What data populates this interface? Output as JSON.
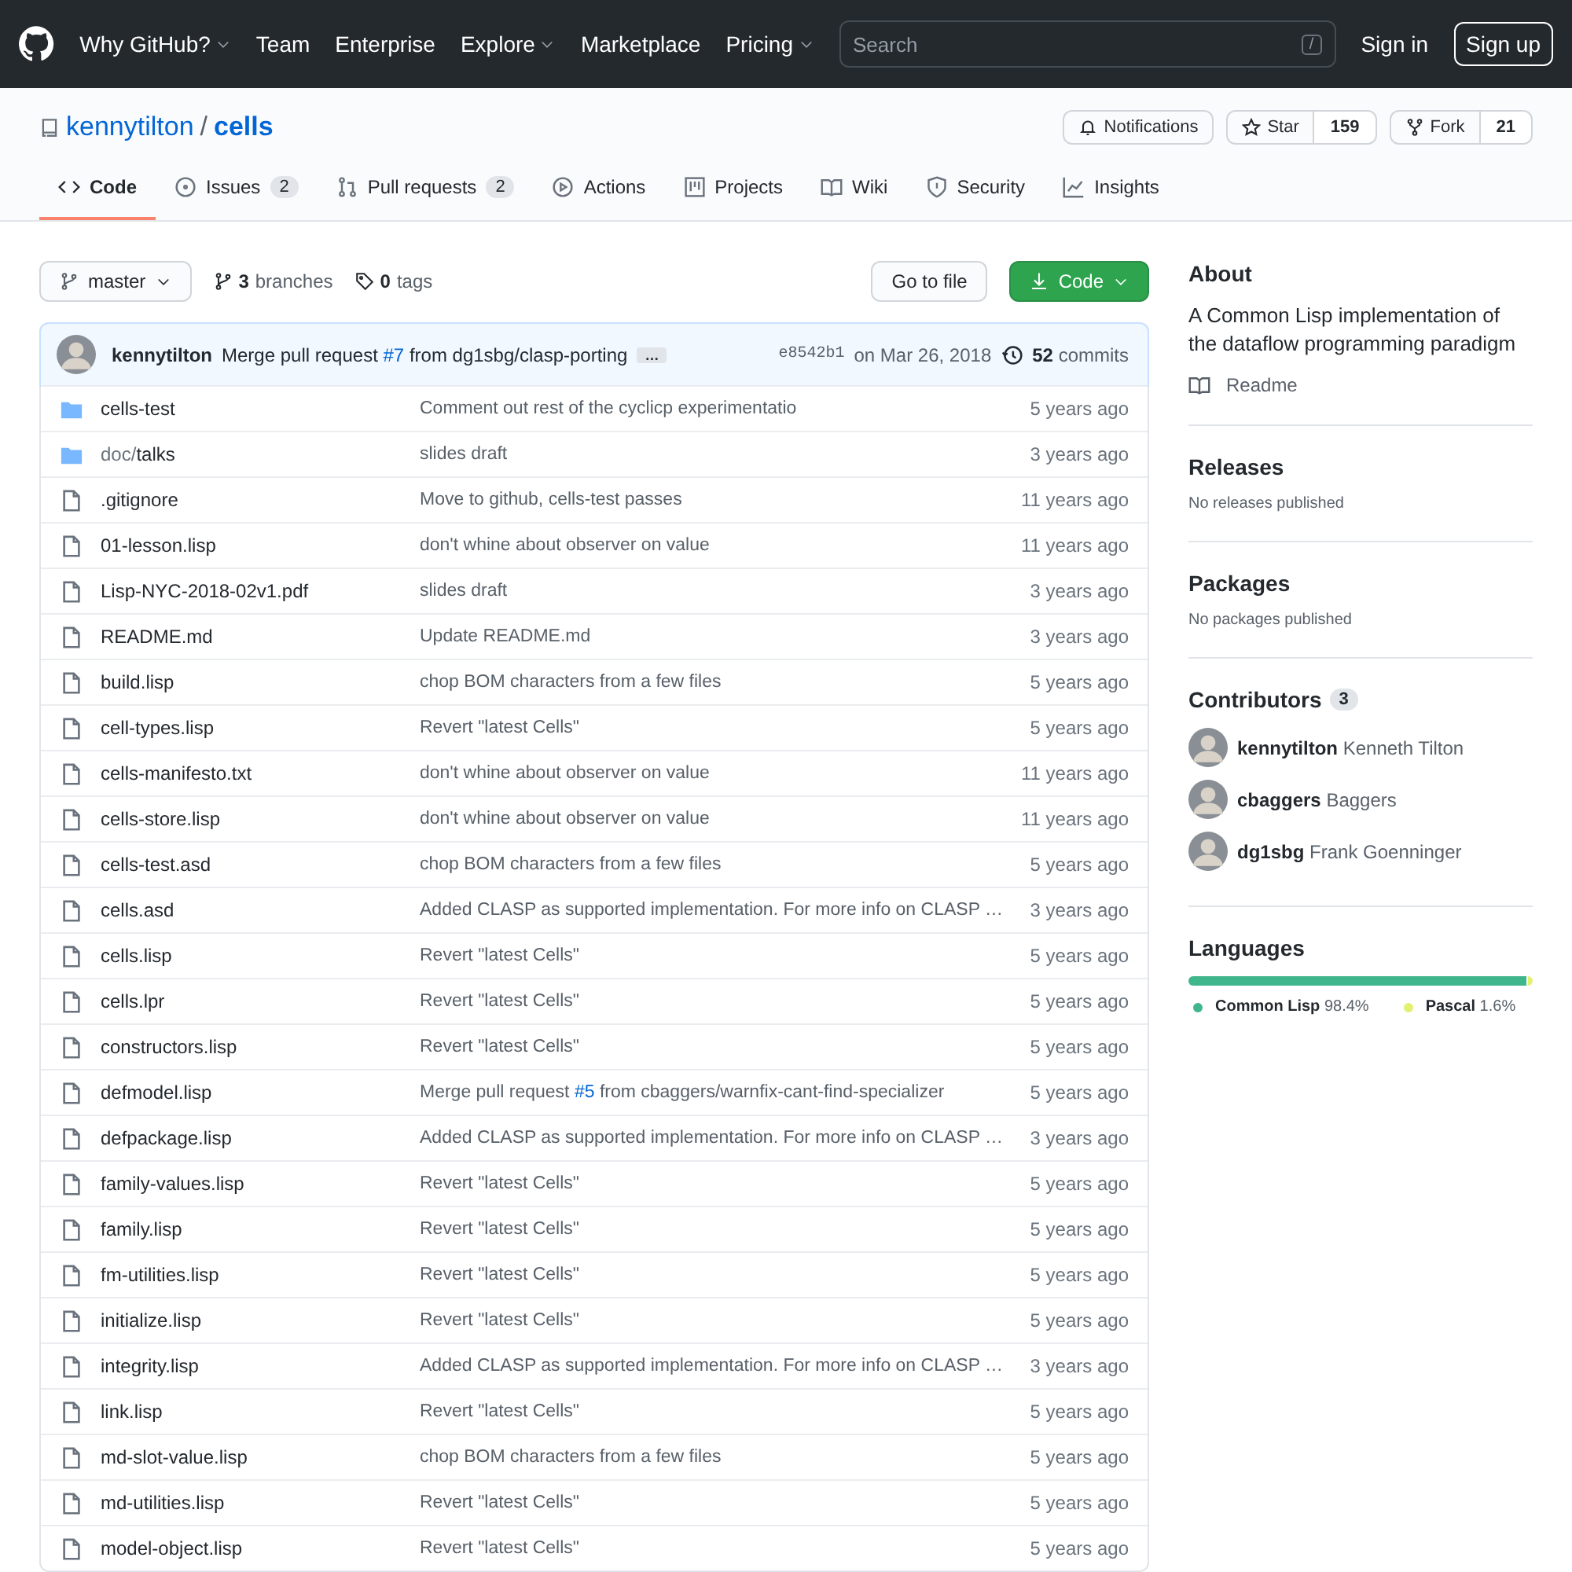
{
  "nav": {
    "links": [
      {
        "label": "Why GitHub?",
        "dropdown": true
      },
      {
        "label": "Team",
        "dropdown": false
      },
      {
        "label": "Enterprise",
        "dropdown": false
      },
      {
        "label": "Explore",
        "dropdown": true
      },
      {
        "label": "Marketplace",
        "dropdown": false
      },
      {
        "label": "Pricing",
        "dropdown": true
      }
    ],
    "search": {
      "placeholder": "Search",
      "shortcut": "/"
    },
    "sign_in": "Sign in",
    "sign_up": "Sign up"
  },
  "repo": {
    "owner": "kennytilton",
    "separator": "/",
    "name": "cells",
    "actions": [
      {
        "kind": "notifications",
        "label": "Notifications"
      },
      {
        "kind": "star",
        "label": "Star",
        "count": "159"
      },
      {
        "kind": "fork",
        "label": "Fork",
        "count": "21"
      }
    ]
  },
  "tabs": [
    {
      "kind": "code",
      "label": "Code",
      "selected": true
    },
    {
      "kind": "issues",
      "label": "Issues",
      "count": "2",
      "selected": false
    },
    {
      "kind": "pull",
      "label": "Pull requests",
      "count": "2",
      "selected": false
    },
    {
      "kind": "actions",
      "label": "Actions",
      "selected": false
    },
    {
      "kind": "projects",
      "label": "Projects",
      "selected": false
    },
    {
      "kind": "wiki",
      "label": "Wiki",
      "selected": false
    },
    {
      "kind": "security",
      "label": "Security",
      "selected": false
    },
    {
      "kind": "insights",
      "label": "Insights",
      "selected": false
    }
  ],
  "toolbar": {
    "branch": "master",
    "branches_count": "3",
    "branches_label": "branches",
    "tags_count": "0",
    "tags_label": "tags",
    "go_to_file": "Go to file",
    "code": "Code"
  },
  "latest_commit": {
    "author": "kennytilton",
    "message": [
      {
        "kind": "text",
        "text": "Merge pull request "
      },
      {
        "kind": "link",
        "text": "#7"
      },
      {
        "kind": "text",
        "text": " from dg1sbg/clasp-porting"
      }
    ],
    "ellipsis": "…",
    "sha": "e8542b1",
    "date": "on Mar 26, 2018",
    "commits_count": "52",
    "commits_label": "commits"
  },
  "files": [
    {
      "kind": "folder",
      "name": "cells-test",
      "message": [
        {
          "kind": "text",
          "text": "Comment out rest of the cyclicp experimentatio"
        }
      ],
      "age": "5 years ago"
    },
    {
      "kind": "folder",
      "prefix": "doc/",
      "name": "talks",
      "message": [
        {
          "kind": "text",
          "text": "slides draft"
        }
      ],
      "age": "3 years ago"
    },
    {
      "kind": "file",
      "name": ".gitignore",
      "message": [
        {
          "kind": "text",
          "text": "Move to github, cells-test passes"
        }
      ],
      "age": "11 years ago"
    },
    {
      "kind": "file",
      "name": "01-lesson.lisp",
      "message": [
        {
          "kind": "text",
          "text": "don't whine about observer on value"
        }
      ],
      "age": "11 years ago"
    },
    {
      "kind": "file",
      "name": "Lisp-NYC-2018-02v1.pdf",
      "message": [
        {
          "kind": "text",
          "text": "slides draft"
        }
      ],
      "age": "3 years ago"
    },
    {
      "kind": "file",
      "name": "README.md",
      "message": [
        {
          "kind": "text",
          "text": "Update README.md"
        }
      ],
      "age": "3 years ago"
    },
    {
      "kind": "file",
      "name": "build.lisp",
      "message": [
        {
          "kind": "text",
          "text": "chop BOM characters from a few files"
        }
      ],
      "age": "5 years ago"
    },
    {
      "kind": "file",
      "name": "cell-types.lisp",
      "message": [
        {
          "kind": "text",
          "text": "Revert \"latest Cells\""
        }
      ],
      "age": "5 years ago"
    },
    {
      "kind": "file",
      "name": "cells-manifesto.txt",
      "message": [
        {
          "kind": "text",
          "text": "don't whine about observer on value"
        }
      ],
      "age": "11 years ago"
    },
    {
      "kind": "file",
      "name": "cells-store.lisp",
      "message": [
        {
          "kind": "text",
          "text": "don't whine about observer on value"
        }
      ],
      "age": "11 years ago"
    },
    {
      "kind": "file",
      "name": "cells-test.asd",
      "message": [
        {
          "kind": "text",
          "text": "chop BOM characters from a few files"
        }
      ],
      "age": "5 years ago"
    },
    {
      "kind": "file",
      "name": "cells.asd",
      "message": [
        {
          "kind": "text",
          "text": "Added CLASP as supported implementation. For more info on CLASP …"
        }
      ],
      "age": "3 years ago"
    },
    {
      "kind": "file",
      "name": "cells.lisp",
      "message": [
        {
          "kind": "text",
          "text": "Revert \"latest Cells\""
        }
      ],
      "age": "5 years ago"
    },
    {
      "kind": "file",
      "name": "cells.lpr",
      "message": [
        {
          "kind": "text",
          "text": "Revert \"latest Cells\""
        }
      ],
      "age": "5 years ago"
    },
    {
      "kind": "file",
      "name": "constructors.lisp",
      "message": [
        {
          "kind": "text",
          "text": "Revert \"latest Cells\""
        }
      ],
      "age": "5 years ago"
    },
    {
      "kind": "file",
      "name": "defmodel.lisp",
      "message": [
        {
          "kind": "text",
          "text": "Merge pull request "
        },
        {
          "kind": "link",
          "text": "#5"
        },
        {
          "kind": "text",
          "text": " from cbaggers/warnfix-cant-find-specializer"
        }
      ],
      "age": "5 years ago"
    },
    {
      "kind": "file",
      "name": "defpackage.lisp",
      "message": [
        {
          "kind": "text",
          "text": "Added CLASP as supported implementation. For more info on CLASP …"
        }
      ],
      "age": "3 years ago"
    },
    {
      "kind": "file",
      "name": "family-values.lisp",
      "message": [
        {
          "kind": "text",
          "text": "Revert \"latest Cells\""
        }
      ],
      "age": "5 years ago"
    },
    {
      "kind": "file",
      "name": "family.lisp",
      "message": [
        {
          "kind": "text",
          "text": "Revert \"latest Cells\""
        }
      ],
      "age": "5 years ago"
    },
    {
      "kind": "file",
      "name": "fm-utilities.lisp",
      "message": [
        {
          "kind": "text",
          "text": "Revert \"latest Cells\""
        }
      ],
      "age": "5 years ago"
    },
    {
      "kind": "file",
      "name": "initialize.lisp",
      "message": [
        {
          "kind": "text",
          "text": "Revert \"latest Cells\""
        }
      ],
      "age": "5 years ago"
    },
    {
      "kind": "file",
      "name": "integrity.lisp",
      "message": [
        {
          "kind": "text",
          "text": "Added CLASP as supported implementation. For more info on CLASP …"
        }
      ],
      "age": "3 years ago"
    },
    {
      "kind": "file",
      "name": "link.lisp",
      "message": [
        {
          "kind": "text",
          "text": "Revert \"latest Cells\""
        }
      ],
      "age": "5 years ago"
    },
    {
      "kind": "file",
      "name": "md-slot-value.lisp",
      "message": [
        {
          "kind": "text",
          "text": "chop BOM characters from a few files"
        }
      ],
      "age": "5 years ago"
    },
    {
      "kind": "file",
      "name": "md-utilities.lisp",
      "message": [
        {
          "kind": "text",
          "text": "Revert \"latest Cells\""
        }
      ],
      "age": "5 years ago"
    },
    {
      "kind": "file",
      "name": "model-object.lisp",
      "message": [
        {
          "kind": "text",
          "text": "Revert \"latest Cells\""
        }
      ],
      "age": "5 years ago"
    }
  ],
  "sidebar": {
    "about": {
      "title": "About",
      "description": "A Common Lisp implementation of the dataflow programming paradigm",
      "readme": "Readme"
    },
    "releases": {
      "title": "Releases",
      "empty": "No releases published"
    },
    "packages": {
      "title": "Packages",
      "empty": "No packages published"
    },
    "contributors": {
      "title": "Contributors",
      "count": "3",
      "people": [
        {
          "login": "kennytilton",
          "name": "Kenneth Tilton"
        },
        {
          "login": "cbaggers",
          "name": "Baggers"
        },
        {
          "login": "dg1sbg",
          "name": "Frank Goenninger"
        }
      ]
    },
    "languages": {
      "title": "Languages",
      "items": [
        {
          "name": "Common Lisp",
          "percent": "98.4%",
          "level": 0.984,
          "color": "#3fb68b"
        },
        {
          "name": "Pascal",
          "percent": "1.6%",
          "color": "#e3f171"
        }
      ]
    }
  }
}
